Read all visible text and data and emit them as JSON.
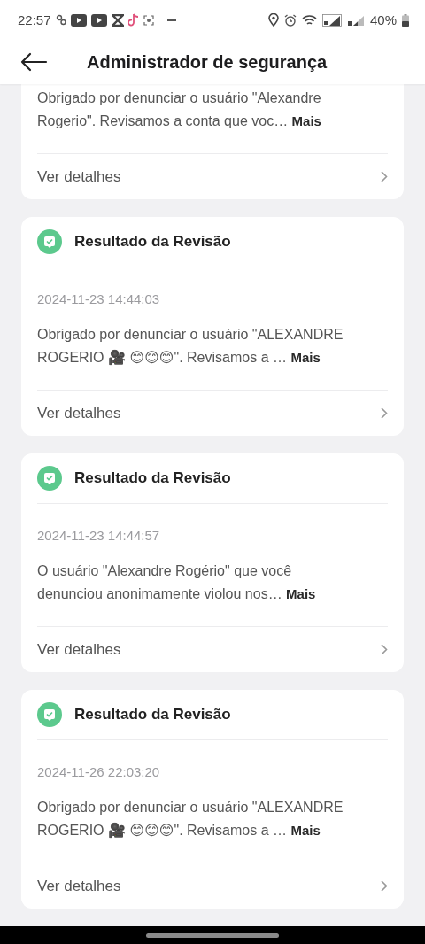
{
  "status_bar": {
    "time": "22:57",
    "battery": "40%"
  },
  "header": {
    "title": "Administrador de segurança"
  },
  "cards": [
    {
      "kind": "partial",
      "message": "Obrigado por denunciar o usuário \"Alexandre Rogerio\". Revisamos a conta que voc…",
      "more": "Mais",
      "details": "Ver detalhes"
    },
    {
      "kind": "full",
      "title": "Resultado da Revisão",
      "date": "2024-11-23 14:44:03",
      "message": "Obrigado por denunciar o usuário \"ALEXANDRE ROGERIO 🎥 😊😊😊\". Revisamos a …",
      "more": "Mais",
      "details": "Ver detalhes"
    },
    {
      "kind": "full",
      "title": "Resultado da Revisão",
      "date": "2024-11-23 14:44:57",
      "message": "O usuário \"Alexandre Rogério\" que você denunciou anonimamente violou nos…",
      "more": "Mais",
      "details": "Ver detalhes"
    },
    {
      "kind": "full",
      "title": "Resultado da Revisão",
      "date": "2024-11-26 22:03:20",
      "message": "Obrigado por denunciar o usuário \"ALEXANDRE ROGERIO 🎥 😊😊😊\". Revisamos a …",
      "more": "Mais",
      "details": "Ver detalhes"
    }
  ]
}
